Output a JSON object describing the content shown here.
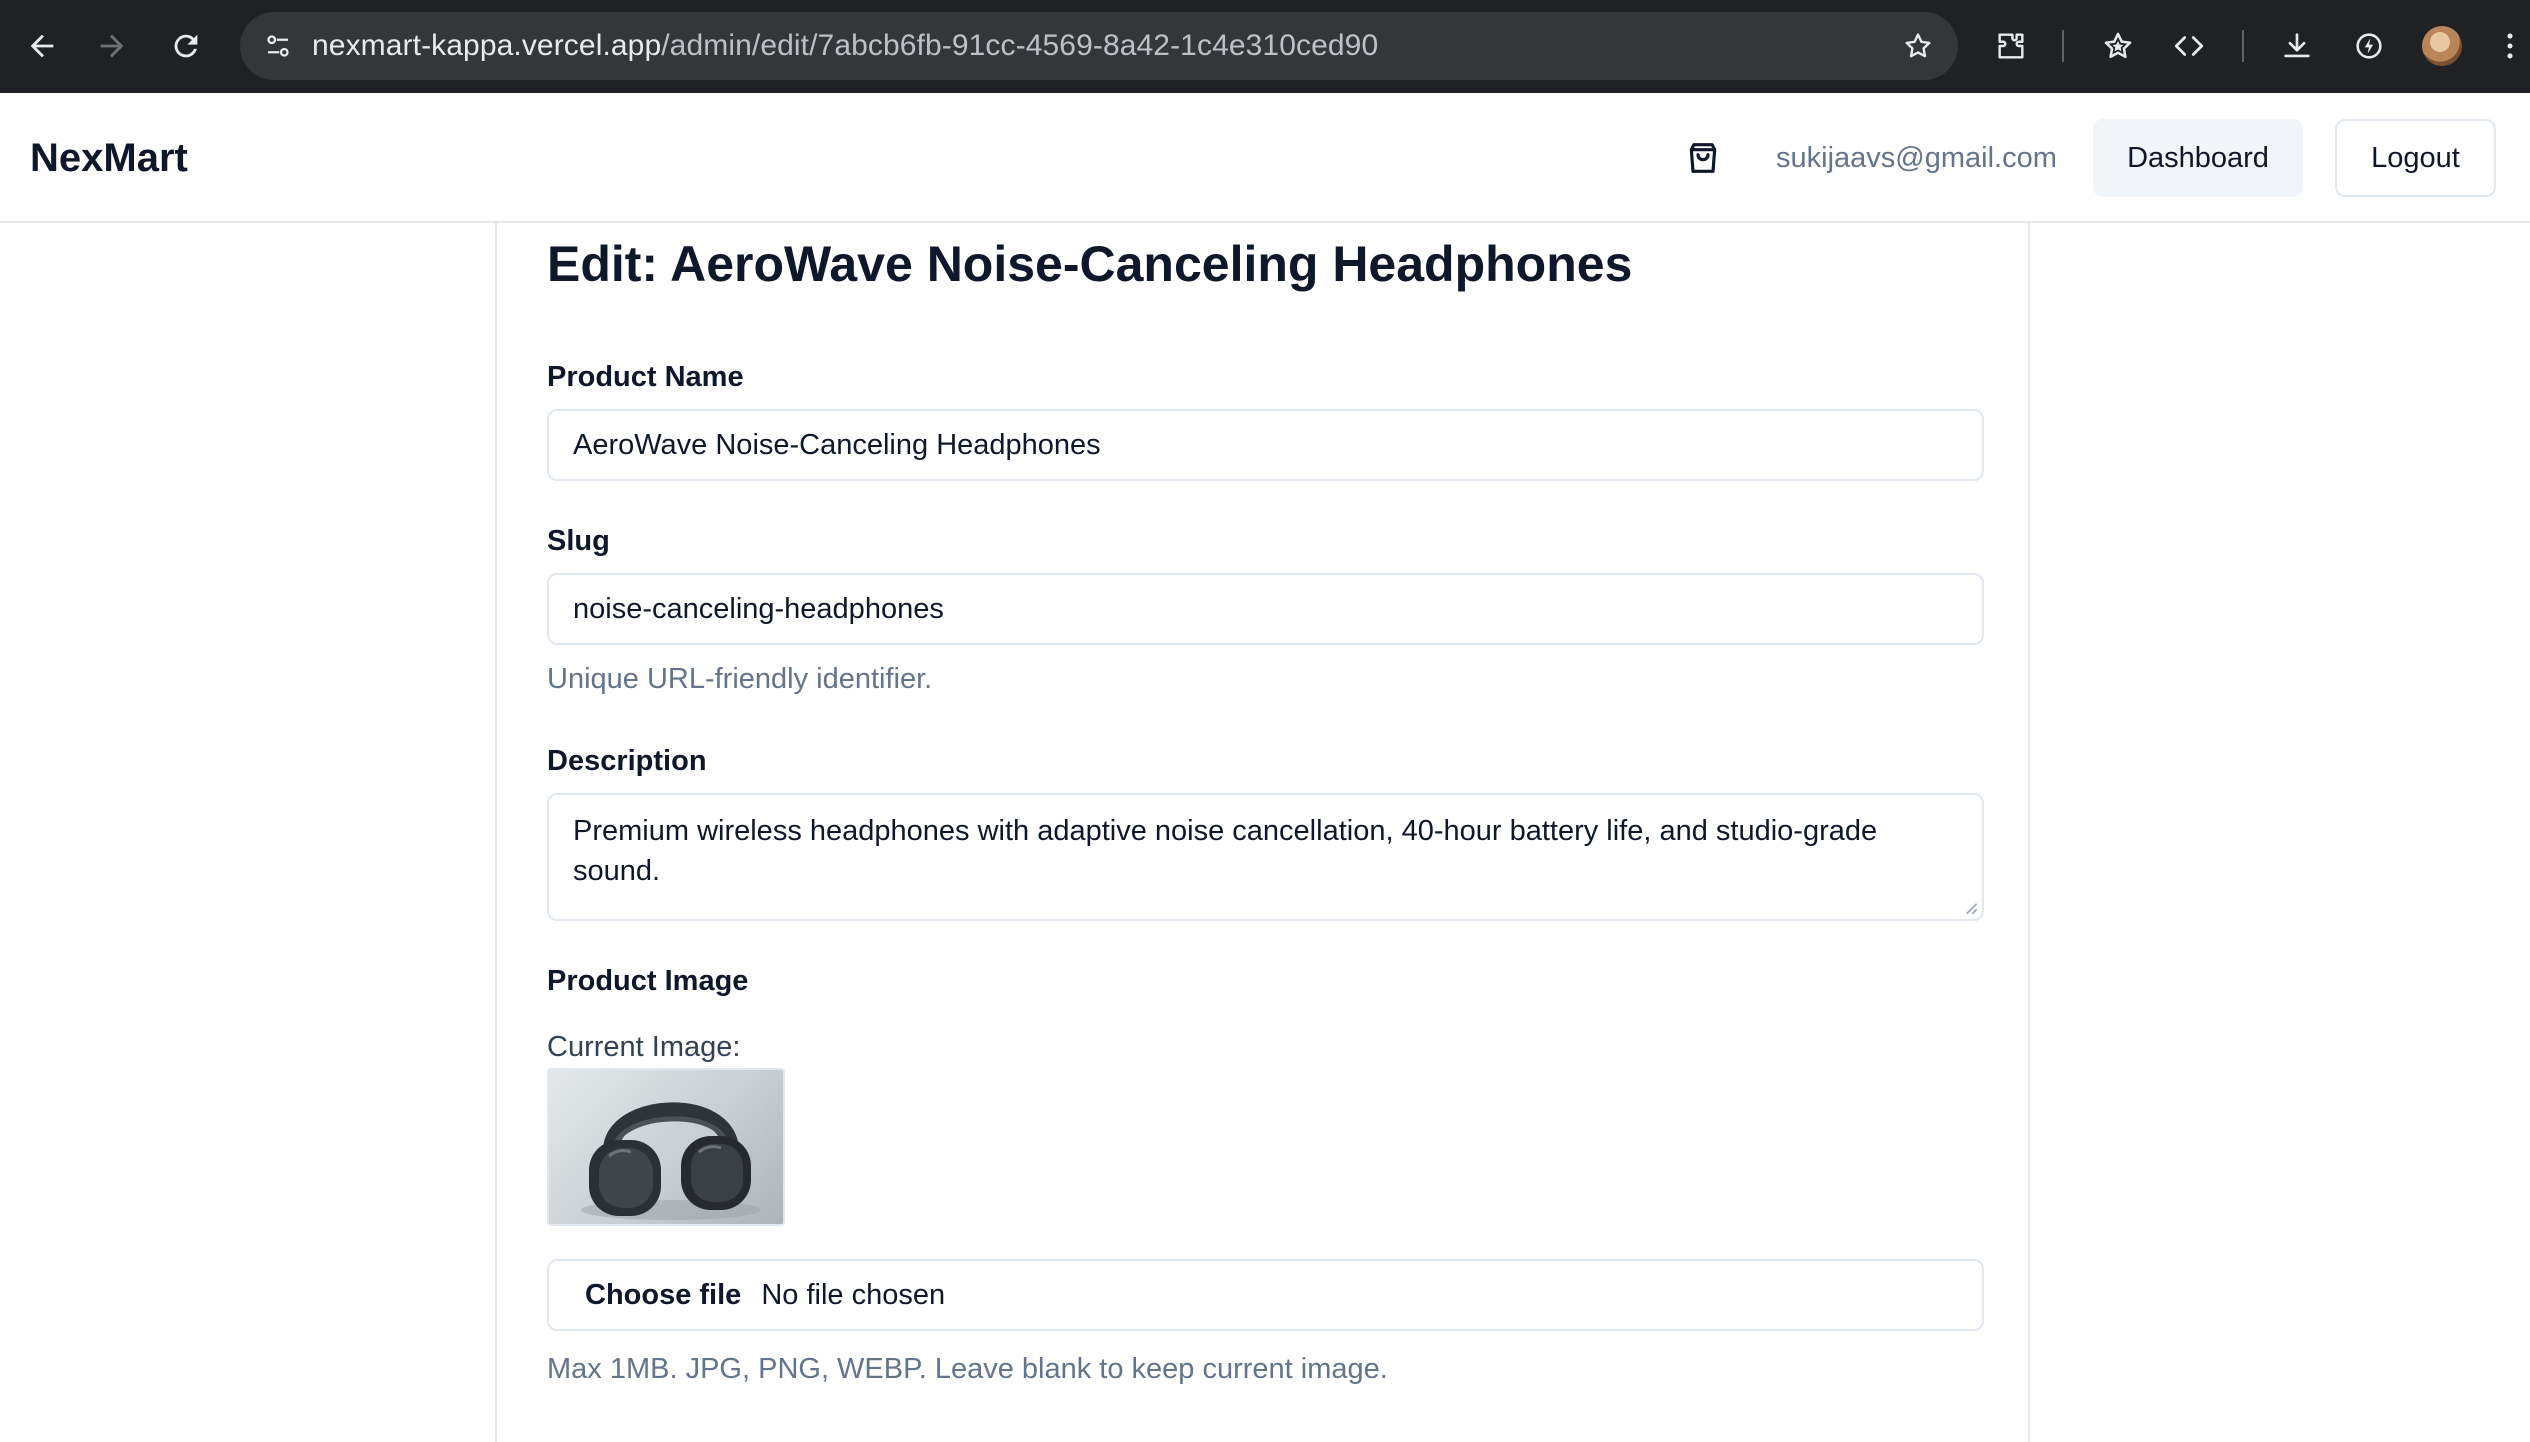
{
  "browser": {
    "url_host": "nexmart-kappa.vercel.app",
    "url_path": "/admin/edit/7abcb6fb-91cc-4569-8a42-1c4e310ced90"
  },
  "header": {
    "brand": "NexMart",
    "user_email": "sukijaavs@gmail.com",
    "dashboard_label": "Dashboard",
    "logout_label": "Logout"
  },
  "form": {
    "title": "Edit: AeroWave Noise-Canceling Headphones",
    "name_label": "Product Name",
    "name_value": "AeroWave Noise-Canceling Headphones",
    "slug_label": "Slug",
    "slug_value": "noise-canceling-headphones",
    "slug_help": "Unique URL-friendly identifier.",
    "description_label": "Description",
    "description_value": "Premium wireless headphones with adaptive noise cancellation, 40-hour battery life, and studio-grade sound.",
    "image_label": "Product Image",
    "current_image_label": "Current Image:",
    "choose_file_label": "Choose file",
    "file_status": "No file chosen",
    "image_help": "Max 1MB. JPG, PNG, WEBP. Leave blank to keep current image."
  },
  "colors": {
    "chrome_bg": "#202124",
    "urlbar_bg": "#35363a",
    "border": "#e2e8f0",
    "muted_text": "#64748b",
    "dashboard_bg": "#f1f5f9"
  }
}
